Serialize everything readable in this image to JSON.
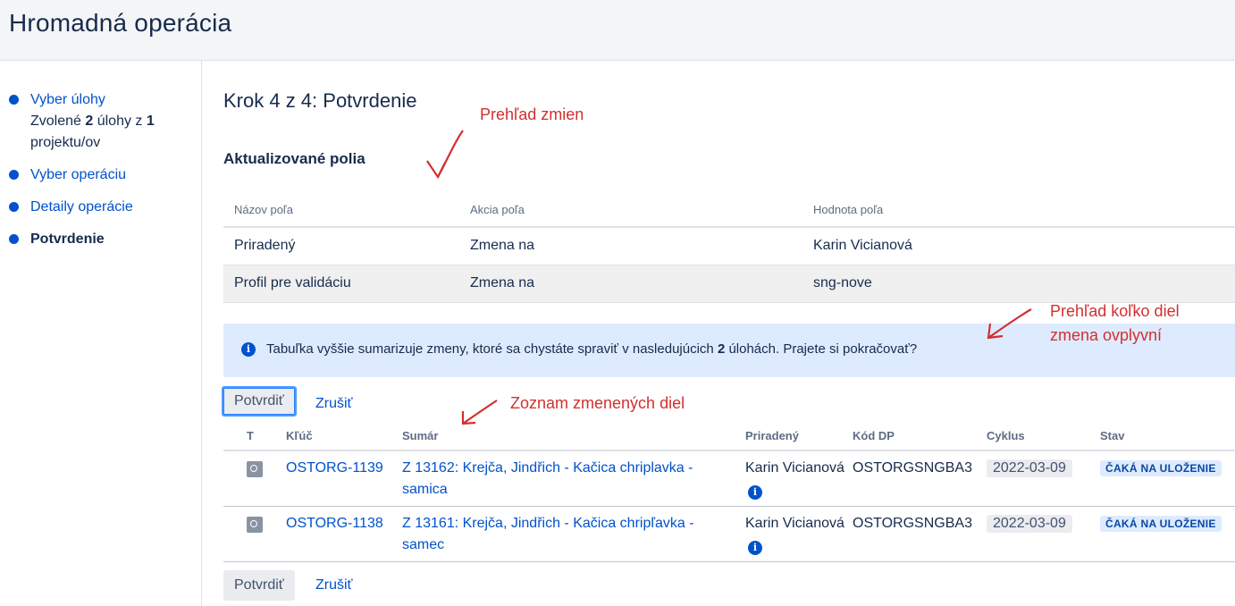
{
  "page": {
    "title": "Hromadná operácia"
  },
  "sidebar": {
    "steps": [
      {
        "label": "Vyber úlohy",
        "desc_pre": "Zvolené ",
        "desc_n1": "2",
        "desc_mid": " úlohy z ",
        "desc_n2": "1",
        "desc_post": " projektu/ov"
      },
      {
        "label": "Vyber operáciu"
      },
      {
        "label": "Detaily operácie"
      },
      {
        "label": "Potvrdenie"
      }
    ]
  },
  "main": {
    "step_title": "Krok 4 z 4: Potvrdenie",
    "fields_title": "Aktualizované polia",
    "fields_table": {
      "headers": [
        "Názov poľa",
        "Akcia poľa",
        "Hodnota poľa"
      ],
      "rows": [
        [
          "Priradený",
          "Zmena na",
          "Karin Vicianová"
        ],
        [
          "Profil pre validáciu",
          "Zmena na",
          "sng-nove"
        ]
      ]
    },
    "info": {
      "pre": "Tabuľka vyššie sumarizuje zmeny, ktoré sa chystáte spraviť v nasledujúcich ",
      "count": "2",
      "post": " úlohách. Prajete si pokračovať?"
    },
    "confirm_label": "Potvrdiť",
    "cancel_label": "Zrušiť",
    "issues_table": {
      "headers": [
        "T",
        "Kľúč",
        "Sumár",
        "Priradený",
        "Kód DP",
        "Cyklus",
        "Stav"
      ],
      "rows": [
        {
          "key": "OSTORG-1139",
          "summary": "Z 13162: Krejča, Jindřich - Kačica chriplavka - samica",
          "assignee": "Karin Vicianová",
          "code": "OSTORGSNGBA3",
          "cycle": "2022-03-09",
          "status": "ČAKÁ NA ULOŽENIE"
        },
        {
          "key": "OSTORG-1138",
          "summary": "Z 13161: Krejča, Jindřich - Kačica chripľavka - samec",
          "assignee": "Karin Vicianová",
          "code": "OSTORGSNGBA3",
          "cycle": "2022-03-09",
          "status": "ČAKÁ NA ULOŽENIE"
        }
      ]
    }
  },
  "annotations": {
    "changes": "Prehľad zmien",
    "impact_line1": "Prehľad koľko diel",
    "impact_line2": "zmena ovplyvní",
    "list": "Zoznam zmenených diel"
  },
  "colors": {
    "accent": "#0052cc",
    "annotation": "#d32f2f",
    "info_bg": "#deebff"
  }
}
